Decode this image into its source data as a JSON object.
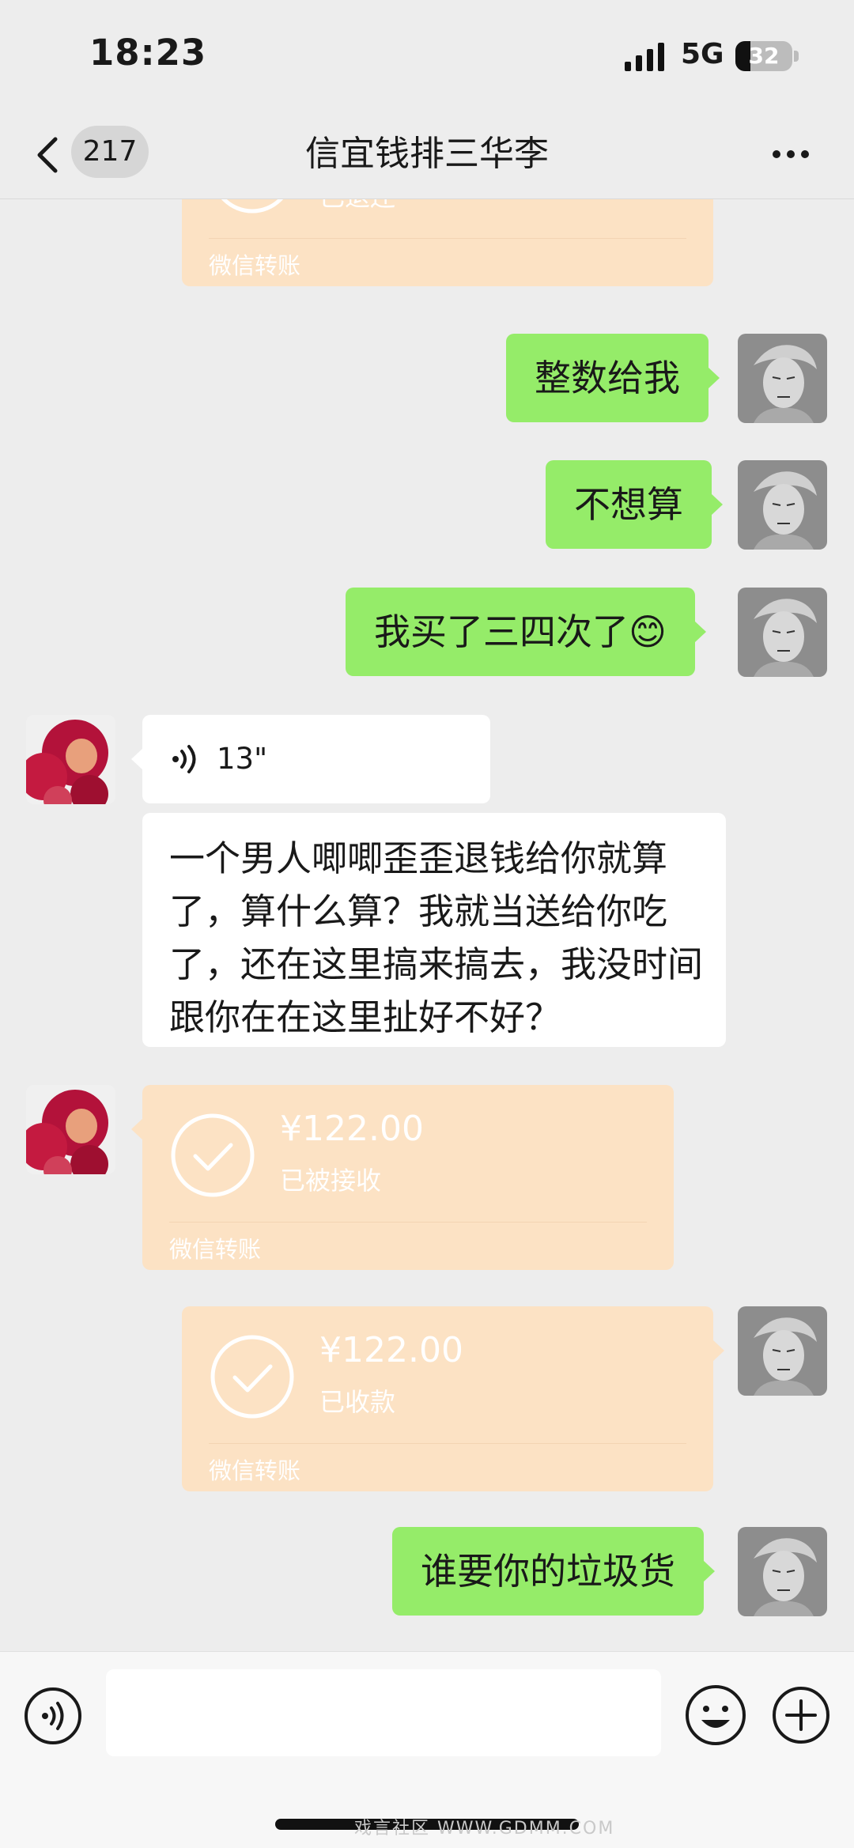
{
  "status_bar": {
    "time": "18:23",
    "network": "5G",
    "battery": "32"
  },
  "header": {
    "back_count": "217",
    "title": "信宜钱排三华李"
  },
  "messages": {
    "m0": {
      "status": "已退还",
      "label": "微信转账"
    },
    "m1": {
      "text": "整数给我"
    },
    "m2": {
      "text": "不想算"
    },
    "m3": {
      "text": "我买了三四次了😊"
    },
    "m4": {
      "duration": "13\""
    },
    "m5": {
      "text": "一个男人唧唧歪歪退钱给你就算了，算什么算？我就当送给你吃了，还在这里搞来搞去，我没时间跟你在在这里扯好不好？"
    },
    "m6": {
      "amount": "¥122.00",
      "status": "已被接收",
      "label": "微信转账"
    },
    "m7": {
      "amount": "¥122.00",
      "status": "已收款",
      "label": "微信转账"
    },
    "m8": {
      "text": "谁要你的垃圾货"
    }
  },
  "watermark": "戏言社区 WWW.GDMM.COM",
  "colors": {
    "background": "#ededed",
    "sent_bubble": "#95ec69",
    "received_bubble": "#ffffff",
    "transfer_card": "#fce2c4"
  },
  "icons": [
    "back-arrow-icon",
    "more-icon",
    "voice-icon",
    "emoji-icon",
    "plus-icon",
    "check-icon",
    "signal-icon",
    "battery-icon"
  ]
}
